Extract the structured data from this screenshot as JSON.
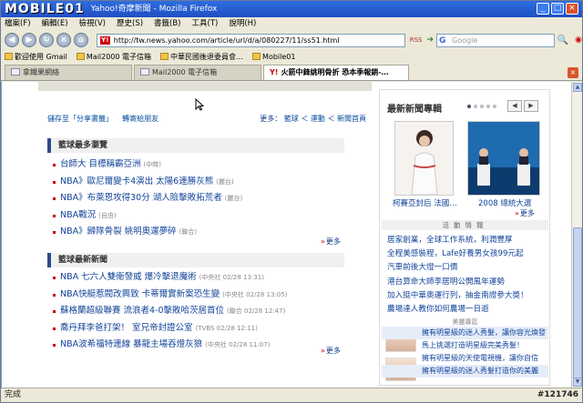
{
  "window": {
    "watermark": "MOBILE01",
    "title": "Yahoo!奇摩新聞 - Mozilla Firefox",
    "menu": [
      "檔案(F)",
      "編輯(E)",
      "檢視(V)",
      "歷史(S)",
      "書籤(B)",
      "工具(T)",
      "說明(H)"
    ],
    "url": "http://tw.news.yahoo.com/article/url/d/a/080227/11/ss51.html",
    "rss_label": "RSS",
    "search_placeholder": "Google",
    "bookmarks": [
      "歡迎使用 Gmail",
      "Mail2000 電子信箱",
      "中華民國後退委員會…",
      "Mobile01"
    ],
    "tabs": [
      "拿鐵果網絡",
      "Mail2000 電子信箱",
      "火箭中鋒姚明骨折 恐本季報銷-…"
    ],
    "active_tab": 2,
    "status": "完成",
    "corner_id": "#121746"
  },
  "share": {
    "save": "儲存至「分享書籤」",
    "email": "轉寄給朋友",
    "more_prefix": "更多：",
    "cats": [
      "籃球",
      "運動",
      "新聞首頁"
    ]
  },
  "section1": {
    "title": "籃球最多瀏覽",
    "items": [
      {
        "text": "台師大 目標稱霸亞洲",
        "src": "(中時)"
      },
      {
        "text": "NBA》歐尼爾變卡4演出 太陽6連勝灰熊",
        "src": "(麗台)"
      },
      {
        "text": "NBA》布萊恩攻得30分 湖人險擊敗拓荒者",
        "src": "(麗台)"
      },
      {
        "text": "NBA戰況",
        "src": "(自由)"
      },
      {
        "text": "NBA》歸隊骨裂 姚明奧運夢碎",
        "src": "(聯合)"
      }
    ],
    "more": "更多"
  },
  "section2": {
    "title": "籃球最新新聞",
    "items": [
      {
        "text": "NBA 七六人雙衛發威 爆冷擊退魔術",
        "src": "(中央社 02/28 13:31)"
      },
      {
        "text": "NBA快艇惹閥改興致   卡蒂爾實新案恐生變",
        "src": "(中央社 02/28 13:05)"
      },
      {
        "text": "蘇格蘭超級聯賽 流浪者4-0擊敗哈茨居首位",
        "src": "(聯合 02/28 12:47)"
      },
      {
        "text": "喬丹拜李爸打架！ 室兄帝封證公室",
        "src": "(TVBS 02/28 12:11)"
      },
      {
        "text": "NBA波希福特連線 暴龍主場吞燈灰狼",
        "src": "(中央社 02/28 11:07)"
      }
    ],
    "more": "更多"
  },
  "sidebar": {
    "title": "最新新聞專輯",
    "photo_captions": [
      "柯賽亞封后 法國…",
      "2008 總統大選"
    ],
    "more": "更多",
    "event_header": "活動情報",
    "events": [
      "居家創業，全球工作系統，利潤豐厚",
      "全程美感裝程，Lafe好養男女孩99元起",
      "汽車前後大燈一口價",
      "港台算命大師李居明公開風年運勢",
      "加入挺中華奧運行列，抽金南證參大獎！",
      "農場達人教你如何農場一日遊"
    ],
    "promo_header": "美麗專區",
    "promos": [
      "擁有明星級的迷人秀髮，讓你容光煥發",
      "馬上挑選打造明星級完美秀髮！",
      "擁有明星級的天使電視機，讓你自信",
      "擁有明星級的迷人秀髮打造你的美麗"
    ]
  }
}
